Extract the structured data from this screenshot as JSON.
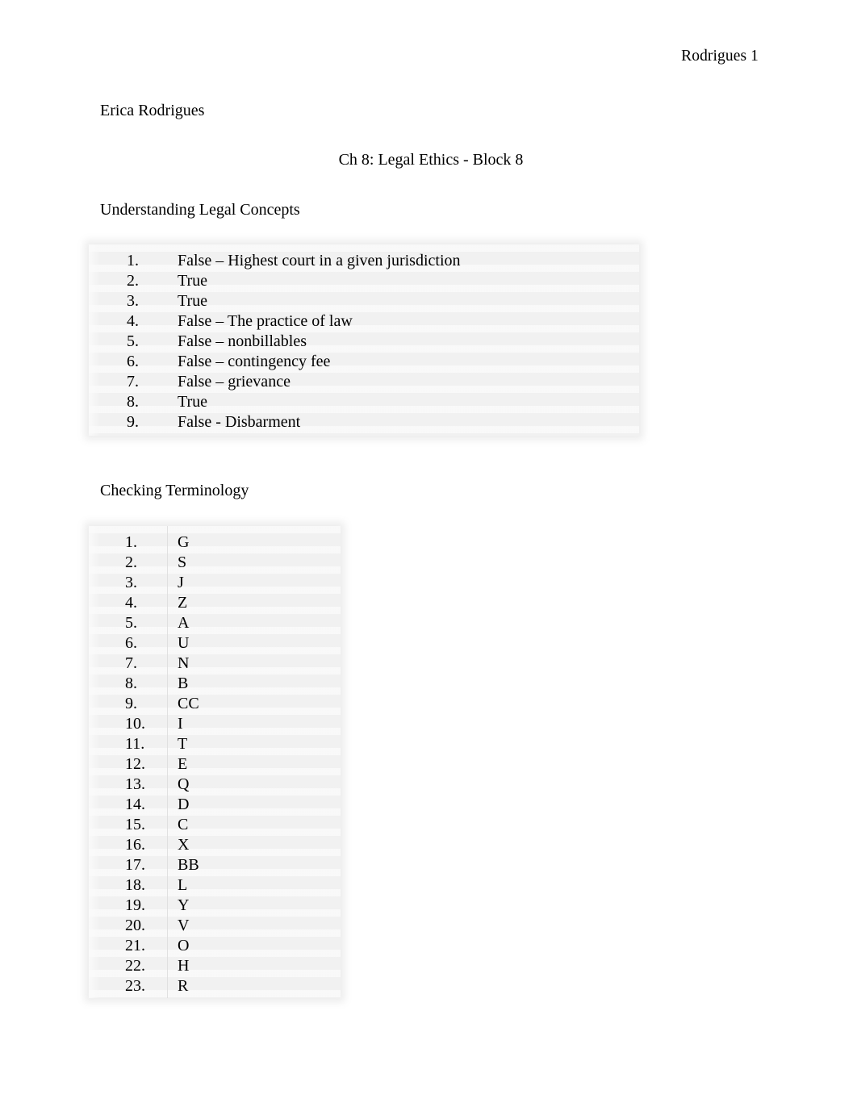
{
  "document": {
    "running_header": "Rodrigues 1",
    "author": "Erica Rodrigues",
    "title": "Ch 8: Legal Ethics - Block 8"
  },
  "sections": [
    {
      "heading": "Understanding Legal Concepts",
      "items": [
        {
          "number": "1.",
          "answer": "False – Highest court in a given jurisdiction"
        },
        {
          "number": "2.",
          "answer": "True"
        },
        {
          "number": "3.",
          "answer": "True"
        },
        {
          "number": "4.",
          "answer": "False – The practice of law"
        },
        {
          "number": "5.",
          "answer": "False – nonbillables"
        },
        {
          "number": "6.",
          "answer": "False – contingency fee"
        },
        {
          "number": "7.",
          "answer": "False – grievance"
        },
        {
          "number": "8.",
          "answer": "True"
        },
        {
          "number": "9.",
          "answer": "False - Disbarment"
        }
      ]
    },
    {
      "heading": "Checking Terminology",
      "items": [
        {
          "number": "1.",
          "answer": "G"
        },
        {
          "number": "2.",
          "answer": "S"
        },
        {
          "number": "3.",
          "answer": "J"
        },
        {
          "number": "4.",
          "answer": "Z"
        },
        {
          "number": "5.",
          "answer": "A"
        },
        {
          "number": "6.",
          "answer": "U"
        },
        {
          "number": "7.",
          "answer": "N"
        },
        {
          "number": "8.",
          "answer": "B"
        },
        {
          "number": "9.",
          "answer": "CC"
        },
        {
          "number": "10.",
          "answer": "I"
        },
        {
          "number": "11.",
          "answer": "T"
        },
        {
          "number": "12.",
          "answer": "E"
        },
        {
          "number": "13.",
          "answer": "Q"
        },
        {
          "number": "14.",
          "answer": "D"
        },
        {
          "number": "15.",
          "answer": "C"
        },
        {
          "number": "16.",
          "answer": "X"
        },
        {
          "number": "17.",
          "answer": "BB"
        },
        {
          "number": "18.",
          "answer": "L"
        },
        {
          "number": "19.",
          "answer": "Y"
        },
        {
          "number": "20.",
          "answer": "V"
        },
        {
          "number": "21.",
          "answer": "O"
        },
        {
          "number": "22.",
          "answer": "H"
        },
        {
          "number": "23.",
          "answer": "R"
        }
      ]
    }
  ],
  "colors": {
    "page_background": "#ffffff",
    "text": "#000000",
    "list_block_background": "#f1f1f1"
  }
}
